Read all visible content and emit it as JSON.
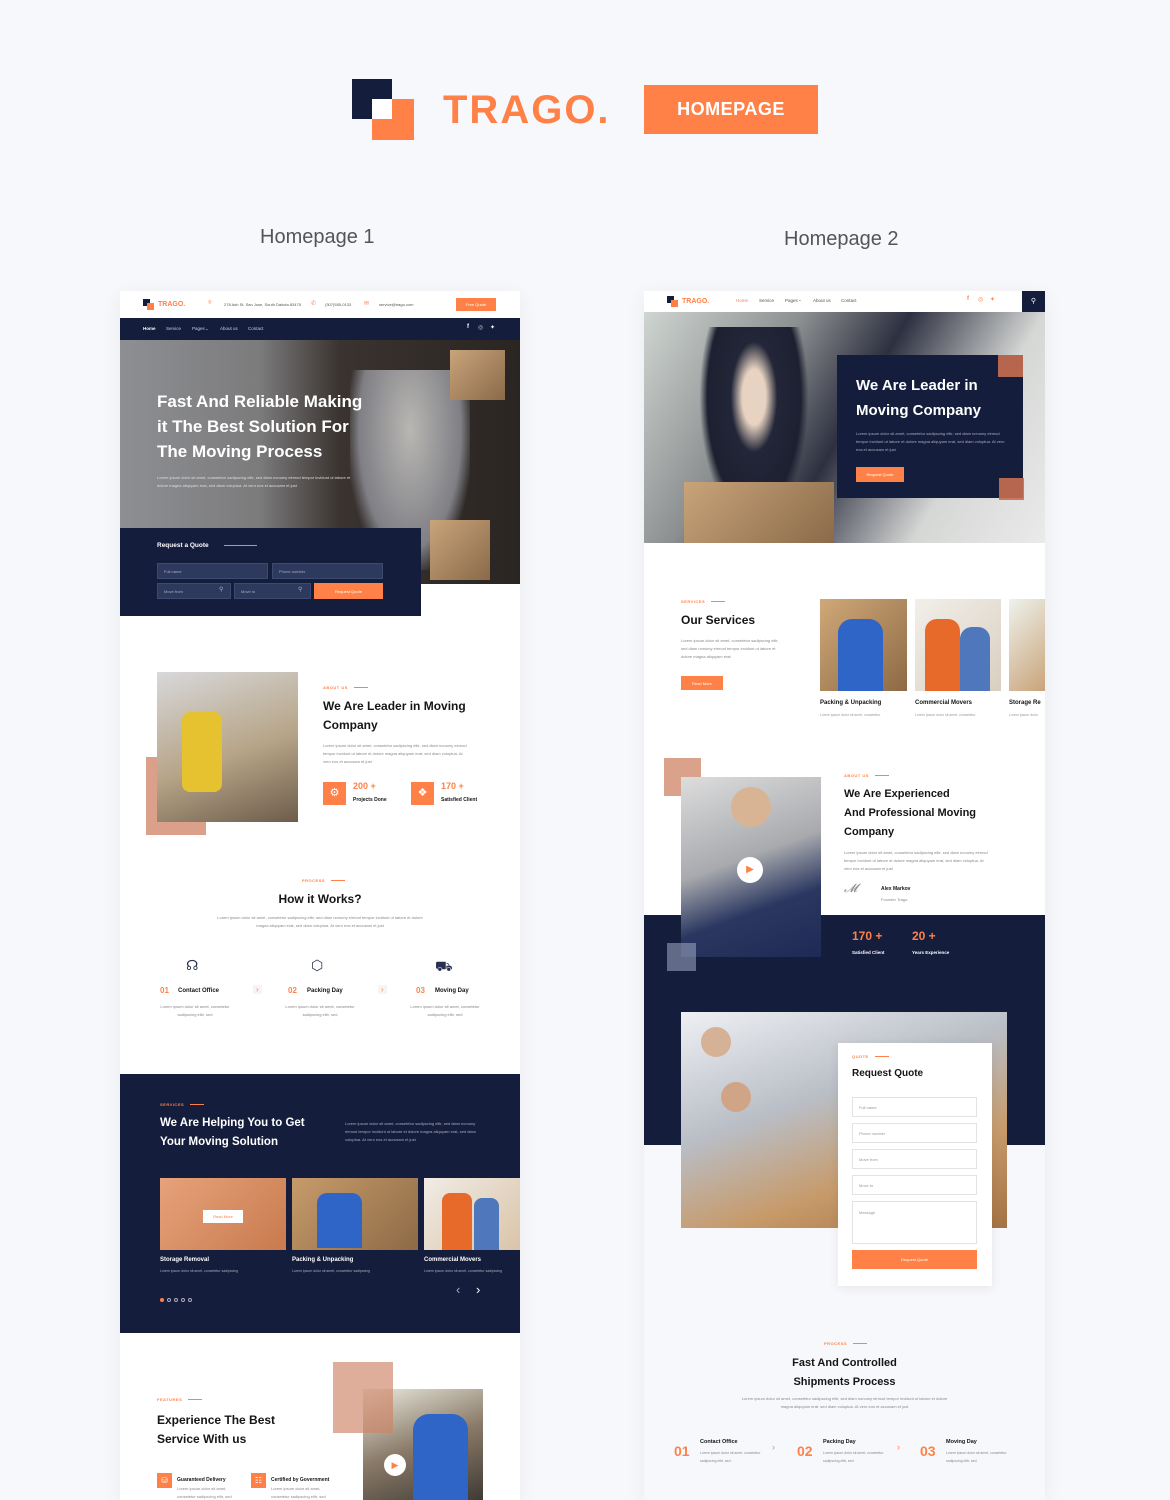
{
  "brand": {
    "name": "TRAGO.",
    "badge": "HOMEPAGE",
    "accent": "#ff8147",
    "navy": "#141e3c"
  },
  "columns": {
    "left": "Homepage 1",
    "right": "Homepage 2"
  },
  "hp1": {
    "topbar": {
      "logo": "TRAGO.",
      "address": "278 Ash St. San Jose, South Dakota 83475",
      "phone": "(307)555-0133",
      "email": "service@trago.com",
      "cta": "Free Quote"
    },
    "nav": {
      "items": [
        "Home",
        "Service",
        "Pages",
        "About us",
        "Contact"
      ],
      "social": [
        "facebook",
        "instagram",
        "twitter"
      ]
    },
    "hero": {
      "title_lines": [
        "Fast And Reliable Making",
        "it The Best Solution For",
        "The Moving Process"
      ],
      "text": "Lorem ipsum dolor sit amet, consetetur sadipscing elitr, sed diam nonumy eirmod tempor invidunt ut labore et dolore magna aliquyam erat, sed diam voluptua. At vero eos et accusam et just"
    },
    "quote": {
      "title": "Request a Quote",
      "fields": [
        "Full name",
        "Phone number",
        "Move from",
        "Move to"
      ],
      "button": "Request Quote"
    },
    "about": {
      "label": "ABOUT US",
      "title_lines": [
        "We Are Leader in Moving",
        "Company"
      ],
      "text": "Lorem ipsum dolor sit amet, consetetur sadipscing elitr, sed diam nonumy eirmod tempor invidunt ut labore et dolore magna aliquyam erat, sed diam voluptua. At vero eos et accusam et just",
      "stats": [
        {
          "value": "200 +",
          "label": "Projects Done"
        },
        {
          "value": "170 +",
          "label": "Satisfied Client"
        }
      ]
    },
    "process": {
      "label": "PROCESS",
      "title": "How it Works?",
      "text": "Lorem ipsum dolor sit amet, consetetur sadipscing elitr, sed diam nonumy eirmod tempor invidunt ut labore et dolore magna aliquyam erat, sed diam voluptua. At vero eos et accusam et just",
      "steps": [
        {
          "num": "01",
          "title": "Contact Office",
          "text": "Lorem ipsum dolor sit amet, consetetur sadipscing elitr, sed"
        },
        {
          "num": "02",
          "title": "Packing Day",
          "text": "Lorem ipsum dolor sit amet, consetetur sadipscing elitr, sed"
        },
        {
          "num": "03",
          "title": "Moving Day",
          "text": "Lorem ipsum dolor sit amet, consetetur sadipscing elitr, sed"
        }
      ]
    },
    "services": {
      "label": "SERVICES",
      "title_lines": [
        "We Are Helping You to Get",
        "Your Moving Solution"
      ],
      "text": "Lorem ipsum dolor sit amet, consetetur sadipscing elitr, sed diam nonumy eirmod tempor invidunt ut labore et dolore magna aliquyam erat, sed diam voluptua. At vero eos et accusam et just",
      "cards": [
        {
          "title": "Storage Removal",
          "text": "Lorem ipsum dolor sit amet, consetetur sadipscing",
          "overlay_button": "Read More"
        },
        {
          "title": "Packing & Unpacking",
          "text": "Lorem ipsum dolor sit amet, consetetur sadipscing"
        },
        {
          "title": "Commercial Movers",
          "text": "Lorem ipsum dolor sit amet, consetetur sadipscing"
        }
      ],
      "pagination": {
        "count": 5,
        "active": 1
      }
    },
    "features": {
      "label": "FEATURES",
      "title_lines": [
        "Experience The Best",
        "Service With us"
      ],
      "items": [
        {
          "title": "Guaranteed Delivery",
          "text": "Lorem ipsum dolor sit amet, consetetur sadipscing elitr, sed"
        },
        {
          "title": "Certified by Government",
          "text": "Lorem ipsum dolor sit amet, consetetur sadipscing elitr, sed"
        }
      ]
    }
  },
  "hp2": {
    "nav": {
      "logo": "TRAGO.",
      "items": [
        "Home",
        "Service",
        "Pages",
        "About us",
        "Contact"
      ],
      "social": [
        "facebook",
        "instagram",
        "twitter"
      ]
    },
    "hero": {
      "title_lines": [
        "We Are Leader in",
        "Moving Company"
      ],
      "text": "Lorem ipsum dolor sit amet, consetetur sadipscing elitr, sed diam nonumy eirmod tempor invidunt ut labore et dolore magna aliquyam erat, sed diam voluptua. At vero eos et accusam et just",
      "button": "Request Quote"
    },
    "services": {
      "label": "SERVICES",
      "title": "Our Services",
      "text": "Lorem ipsum dolor sit amet, consetetur sadipscing elitr, sed diam nonumy eirmod tempor invidunt ut labore et dolore magna aliquyam erat",
      "button": "Read More",
      "cards": [
        {
          "title": "Packing & Unpacking",
          "text": "Lorem ipsum dolor sit amet, consetetur"
        },
        {
          "title": "Commercial Movers",
          "text": "Lorem ipsum dolor sit amet, consetetur"
        },
        {
          "title": "Storage Re",
          "text": "Lorem ipsum dolor"
        }
      ]
    },
    "about": {
      "label": "ABOUT US",
      "title_lines": [
        "We Are Experienced",
        "And Professional Moving",
        "Company"
      ],
      "text": "Lorem ipsum dolor sit amet, consetetur sadipscing elitr, sed diam nonumy eirmod tempor invidunt ut labore et dolore magna aliquyam erat, sed diam voluptua. At vero eos et accusam et just",
      "founder_name": "Alex Markov",
      "founder_role": "Founder Trago.",
      "stats": [
        {
          "value": "170 +",
          "label": "Satisfied Client"
        },
        {
          "value": "20 +",
          "label": "Years Experience"
        }
      ]
    },
    "quote": {
      "label": "QUOTE",
      "title": "Request Quote",
      "fields": [
        "Full name",
        "Phone number",
        "Move from",
        "Move to"
      ],
      "message": "Message",
      "button": "Request Quote"
    },
    "process": {
      "label": "PROCESS",
      "title_lines": [
        "Fast And Controlled",
        "Shipments Process"
      ],
      "text": "Lorem ipsum dolor sit amet, consetetur sadipscing elitr, sed diam nonumy eirmod tempor invidunt ut labore et dolore magna aliquyam erat, sed diam voluptua. At vero eos et accusam et just",
      "steps": [
        {
          "num": "01",
          "title": "Contact Office",
          "text": "Lorem ipsum dolor sit amet, consetetur sadipscing elitr, sed"
        },
        {
          "num": "02",
          "title": "Packing Day",
          "text": "Lorem ipsum dolor sit amet, consetetur sadipscing elitr, sed"
        },
        {
          "num": "03",
          "title": "Moving Day",
          "text": "Lorem ipsum dolor sit amet, consetetur sadipscing elitr, sed"
        }
      ]
    }
  }
}
